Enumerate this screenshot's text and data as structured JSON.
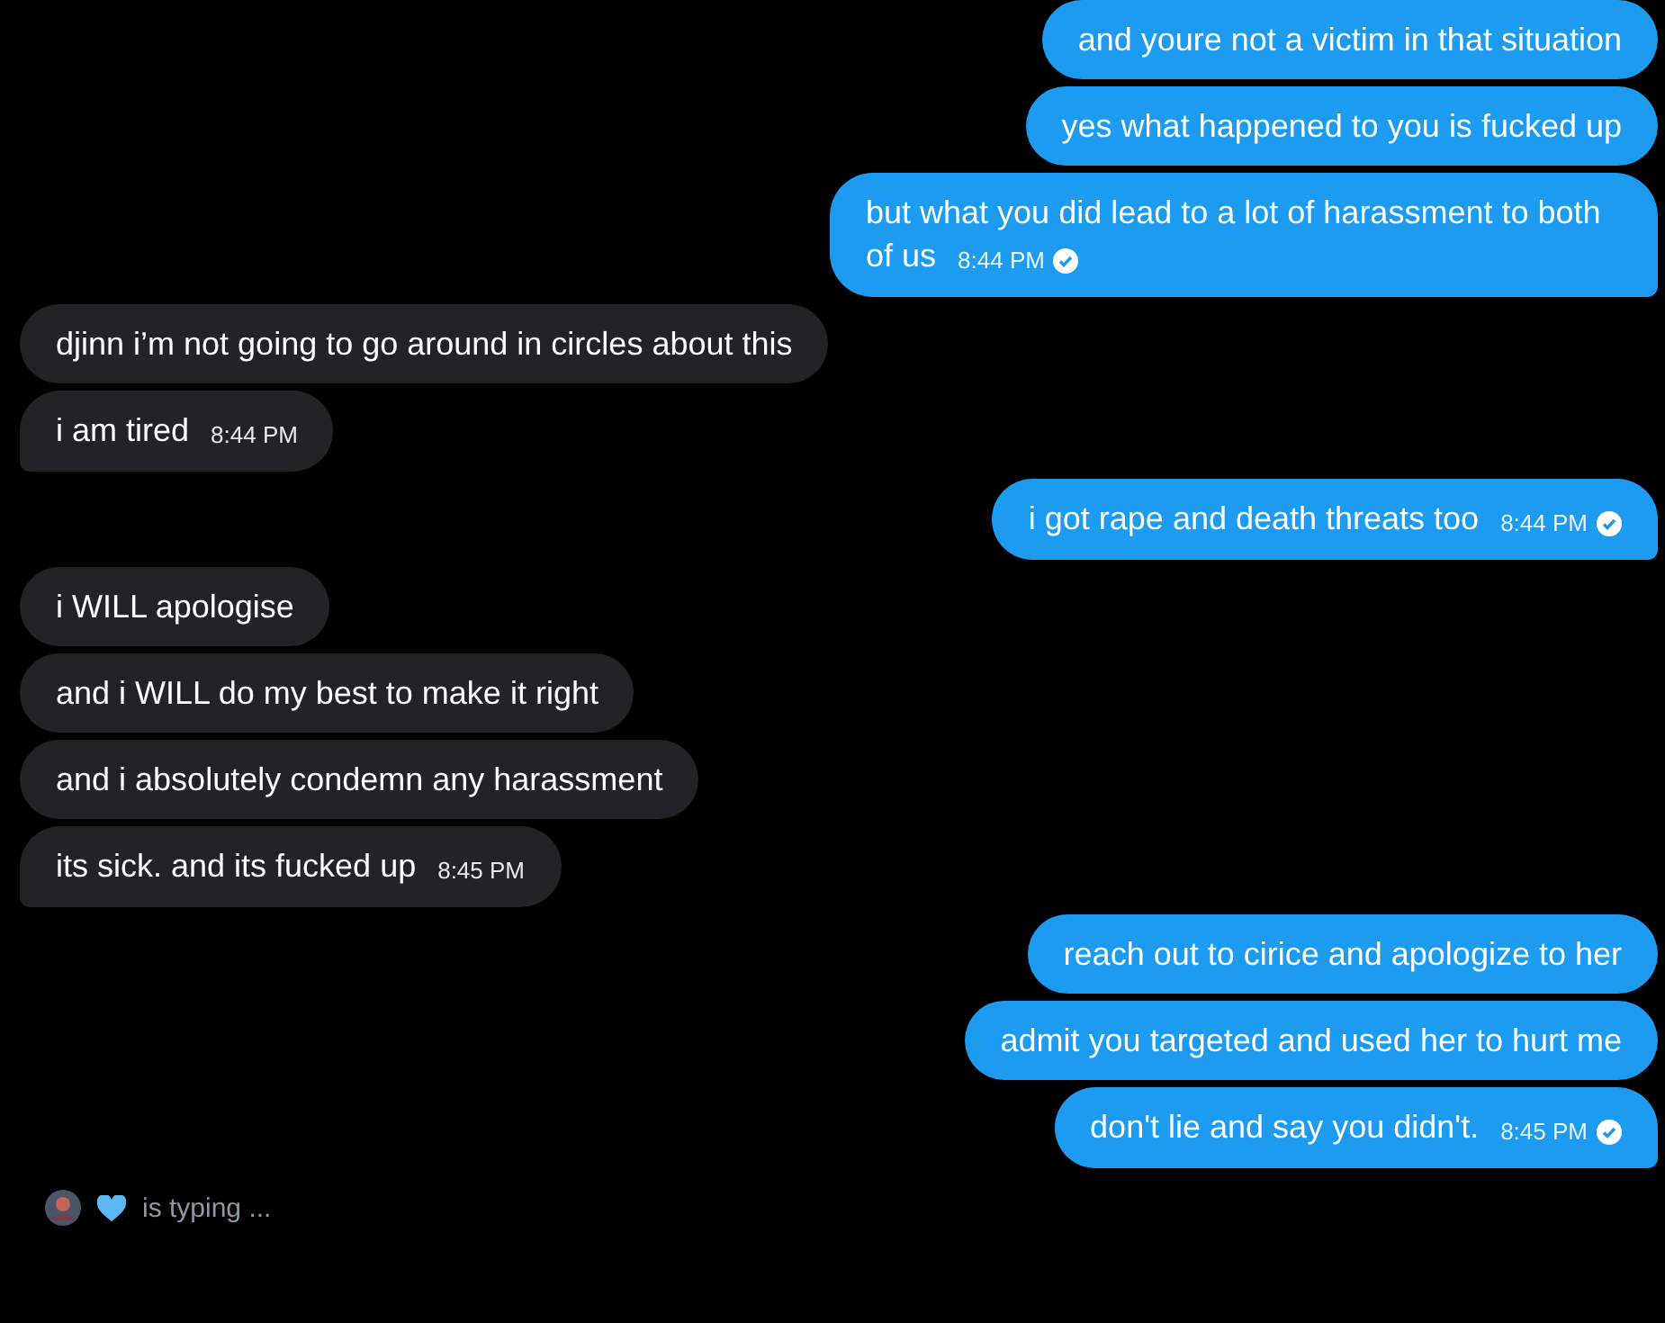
{
  "messages": [
    {
      "kind": "sent",
      "text": "and youre not a victim in that situation"
    },
    {
      "kind": "sent",
      "text": "yes what happened to you is fucked up"
    },
    {
      "kind": "sent",
      "text": "but what you did lead to a lot of harassment to both of us",
      "time": "8:44 PM",
      "read": true
    },
    {
      "kind": "received",
      "text": "djinn i’m not going to go around in circles about this"
    },
    {
      "kind": "received",
      "text": "i am tired",
      "time": "8:44 PM"
    },
    {
      "kind": "sent",
      "text": "i got rape and death threats too",
      "time": "8:44 PM",
      "read": true
    },
    {
      "kind": "received",
      "text": "i WILL apologise"
    },
    {
      "kind": "received",
      "text": "and i WILL do my best to make it right"
    },
    {
      "kind": "received",
      "text": "and i absolutely condemn any harassment"
    },
    {
      "kind": "received",
      "text": "its sick. and its fucked up",
      "time": "8:45 PM"
    },
    {
      "kind": "sent",
      "text": "reach out to cirice and apologize to her"
    },
    {
      "kind": "sent",
      "text": "admit you targeted and used her to hurt me"
    },
    {
      "kind": "sent",
      "text": "don't lie and say you didn't.",
      "time": "8:45 PM",
      "read": true
    }
  ],
  "typing": {
    "text": "is typing ..."
  }
}
